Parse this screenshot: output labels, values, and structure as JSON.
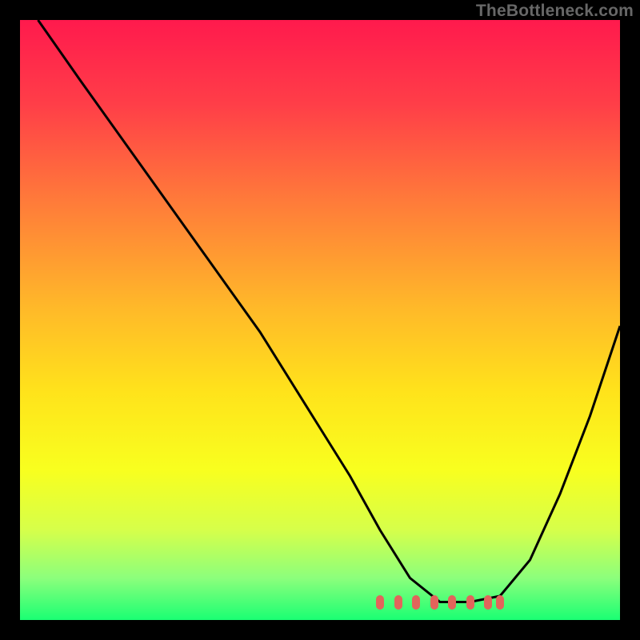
{
  "watermark": "TheBottleneck.com",
  "chart_data": {
    "type": "line",
    "title": "",
    "xlabel": "",
    "ylabel": "",
    "xlim": [
      0,
      100
    ],
    "ylim": [
      0,
      100
    ],
    "curve": {
      "name": "bottleneck-curve",
      "x": [
        3,
        10,
        20,
        30,
        40,
        50,
        55,
        60,
        65,
        70,
        75,
        80,
        85,
        90,
        95,
        100
      ],
      "y": [
        100,
        90,
        76,
        62,
        48,
        32,
        24,
        15,
        7,
        3,
        3,
        4,
        10,
        21,
        34,
        49
      ]
    },
    "optimal_zone": {
      "points_x": [
        60,
        63,
        66,
        69,
        72,
        75,
        78,
        80
      ],
      "y": 3
    },
    "gradient_stops": [
      {
        "pct": 0,
        "color": "#ff1a4d"
      },
      {
        "pct": 14,
        "color": "#ff3e48"
      },
      {
        "pct": 30,
        "color": "#ff7a3a"
      },
      {
        "pct": 48,
        "color": "#ffb929"
      },
      {
        "pct": 62,
        "color": "#ffe31b"
      },
      {
        "pct": 75,
        "color": "#f8ff1f"
      },
      {
        "pct": 85,
        "color": "#d6ff4a"
      },
      {
        "pct": 93,
        "color": "#8cff7c"
      },
      {
        "pct": 100,
        "color": "#1aff73"
      }
    ]
  }
}
